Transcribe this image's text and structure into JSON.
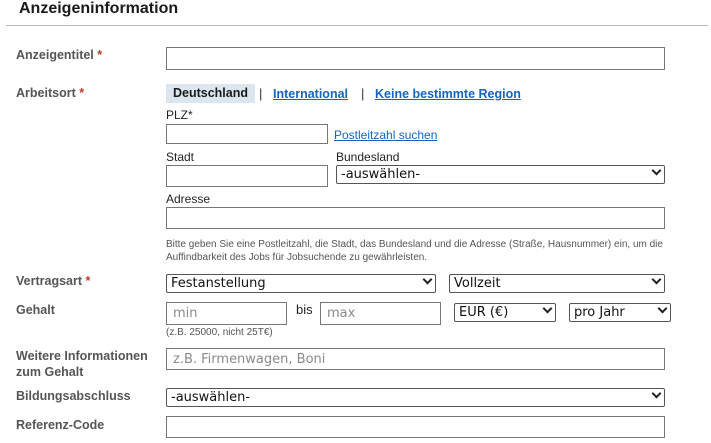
{
  "section": {
    "title": "Anzeigeninformation"
  },
  "fields": {
    "anzeigentitel": {
      "label": "Anzeigentitel",
      "required": "*",
      "value": ""
    },
    "arbeitsort": {
      "label": "Arbeitsort",
      "required": "*",
      "tabs": [
        "Deutschland",
        "International",
        "Keine bestimmte Region"
      ],
      "separator": "|",
      "plz_label": "PLZ*",
      "plz_value": "",
      "plz_link": "Postleitzahl suchen",
      "stadt_label": "Stadt",
      "bundesland_label": "Bundesland",
      "bundesland_value": "-auswählen-",
      "adresse_label": "Adresse",
      "hint": "Bitte geben Sie eine Postleitzahl, die Stadt, das Bundesland und die Adresse (Straße, Hausnummer) ein, um die Auffindbarkeit des Jobs für Jobsuchende zu gewährleisten."
    },
    "vertragsart": {
      "label": "Vertragsart",
      "required": "*",
      "type_value": "Festanstellung",
      "time_value": "Vollzeit"
    },
    "gehalt": {
      "label": "Gehalt",
      "min_placeholder": "min",
      "bis": "bis",
      "max_placeholder": "max",
      "currency_value": "EUR (€)",
      "period_value": "pro Jahr",
      "hint": "(z.B. 25000, nicht 25T€)"
    },
    "weitere": {
      "label_line1": "Weitere Informationen",
      "label_line2": "zum Gehalt",
      "placeholder": "z.B. Firmenwagen, Boni"
    },
    "bildungsabschluss": {
      "label": "Bildungsabschluss",
      "value": "-auswählen-"
    },
    "referenz": {
      "label": "Referenz-Code",
      "value": ""
    }
  }
}
